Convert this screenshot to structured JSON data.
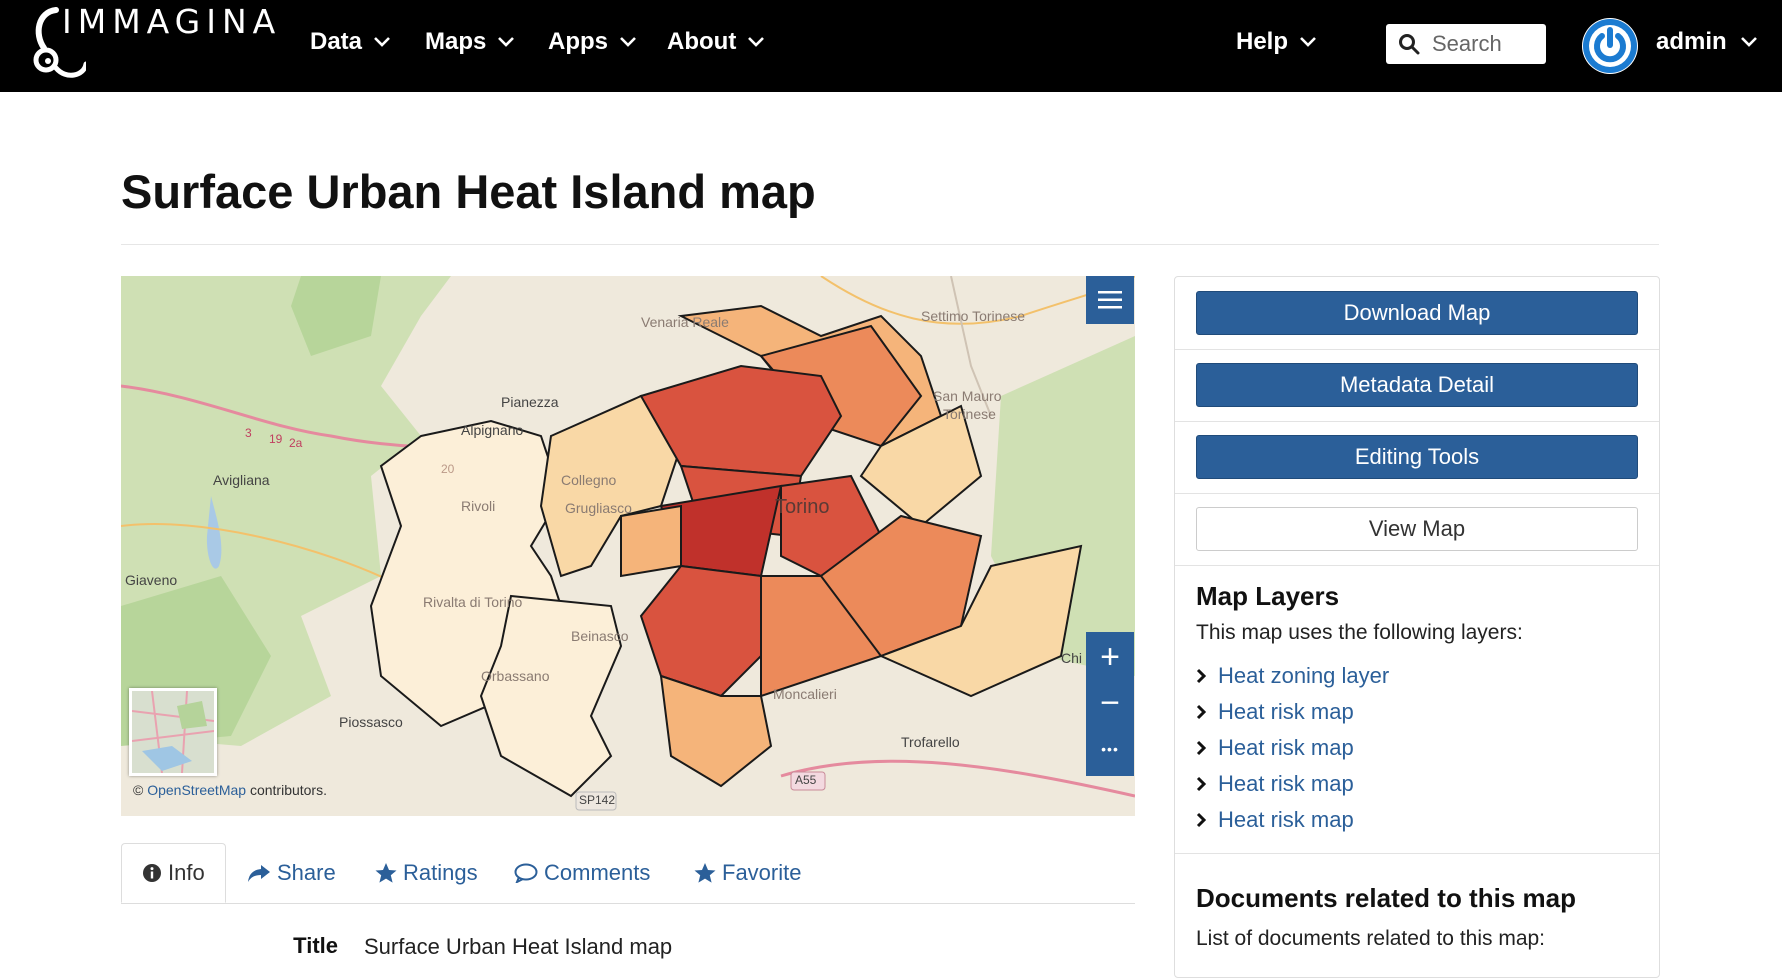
{
  "brand": {
    "name": "IMMAGINA"
  },
  "nav": {
    "items": [
      {
        "label": "Data"
      },
      {
        "label": "Maps"
      },
      {
        "label": "Apps"
      },
      {
        "label": "About"
      }
    ],
    "help_label": "Help",
    "search_placeholder": "Search",
    "user_name": "admin"
  },
  "page": {
    "title": "Surface Urban Heat Island map"
  },
  "map": {
    "attribution_prefix": "©",
    "attribution_link": "OpenStreetMap",
    "attribution_suffix": "contributors.",
    "controls": {
      "zoom_in": "+",
      "zoom_out": "−",
      "more": "•••"
    },
    "place_labels": {
      "pianezza": "Pianezza",
      "alpignano": "Alpignano",
      "avigliana": "Avigliana",
      "giaveno": "Giaveno",
      "rivoli": "Rivoli",
      "collegno": "Collegno",
      "grugliasco": "Grugliasco",
      "torino": "Torino",
      "venaria": "Venaria Reale",
      "settimo": "Settimo Torinese",
      "san_mauro": "San Mauro",
      "san_mauro2": "Torinese",
      "rivalta": "Rivalta di Torino",
      "beinasco": "Beinasco",
      "orbassano": "Orbassano",
      "piossasco": "Piossasco",
      "moncalieri": "Moncalieri",
      "trofarello": "Trofarello",
      "chieri": "Chi",
      "road_a55": "A55",
      "road_sp142": "SP142",
      "road_19": "19",
      "road_2a": "2a",
      "road_3": "3",
      "road_20": "20"
    },
    "colors": {
      "very_high": "#c0312b",
      "high": "#d9533f",
      "medium_high": "#ec8a5a",
      "medium": "#f5b47a",
      "low": "#f9d8a6",
      "very_low": "#fcefd8"
    }
  },
  "tabs": [
    {
      "label": "Info",
      "icon": "info-circle-icon"
    },
    {
      "label": "Share",
      "icon": "share-icon"
    },
    {
      "label": "Ratings",
      "icon": "star-icon"
    },
    {
      "label": "Comments",
      "icon": "comment-icon"
    },
    {
      "label": "Favorite",
      "icon": "star-icon"
    }
  ],
  "info": {
    "title_key": "Title",
    "title_value": "Surface Urban Heat Island map"
  },
  "sidebar": {
    "buttons": {
      "download": "Download Map",
      "metadata": "Metadata Detail",
      "editing": "Editing Tools",
      "view": "View Map"
    },
    "layers_heading": "Map Layers",
    "layers_intro": "This map uses the following layers:",
    "layers": [
      {
        "label": "Heat zoning layer"
      },
      {
        "label": "Heat risk map"
      },
      {
        "label": "Heat risk map"
      },
      {
        "label": "Heat risk map"
      },
      {
        "label": "Heat risk map"
      }
    ],
    "documents_heading": "Documents related to this map",
    "documents_intro": "List of documents related to this map:"
  }
}
